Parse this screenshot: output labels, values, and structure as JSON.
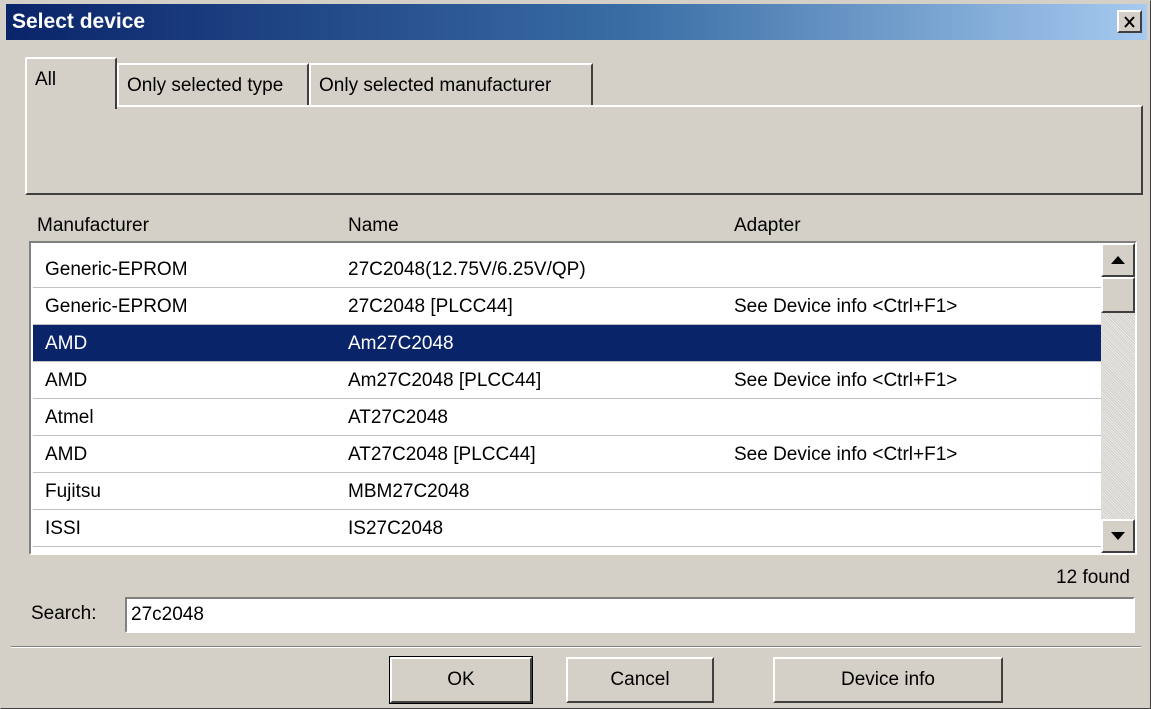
{
  "window": {
    "title": "Select device"
  },
  "tabs": [
    {
      "label": "All",
      "active": true
    },
    {
      "label": "Only selected type",
      "active": false
    },
    {
      "label": "Only selected manufacturer",
      "active": false
    }
  ],
  "columns": {
    "manufacturer": "Manufacturer",
    "name": "Name",
    "adapter": "Adapter"
  },
  "devices": [
    {
      "manufacturer": "Generic-EPROM",
      "name": "27C2048(12.75V/6.25V/QP)",
      "adapter": "",
      "selected": false
    },
    {
      "manufacturer": "Generic-EPROM",
      "name": "27C2048 [PLCC44]",
      "adapter": "See Device info <Ctrl+F1>",
      "selected": false
    },
    {
      "manufacturer": "AMD",
      "name": "Am27C2048",
      "adapter": "",
      "selected": true
    },
    {
      "manufacturer": "AMD",
      "name": "Am27C2048 [PLCC44]",
      "adapter": "See Device info <Ctrl+F1>",
      "selected": false
    },
    {
      "manufacturer": "Atmel",
      "name": "AT27C2048",
      "adapter": "",
      "selected": false
    },
    {
      "manufacturer": "AMD",
      "name": "AT27C2048 [PLCC44]",
      "adapter": "See Device info <Ctrl+F1>",
      "selected": false
    },
    {
      "manufacturer": "Fujitsu",
      "name": "MBM27C2048",
      "adapter": "",
      "selected": false
    },
    {
      "manufacturer": "ISSI",
      "name": "IS27C2048",
      "adapter": "",
      "selected": false
    }
  ],
  "results": {
    "found_text": "12 found"
  },
  "search": {
    "label": "Search:",
    "value": "27c2048"
  },
  "buttons": {
    "ok": "OK",
    "cancel": "Cancel",
    "device_info": "Device info"
  },
  "colors": {
    "titlebar_start": "#0a246a",
    "titlebar_end": "#a6caf0",
    "selection": "#0a246a",
    "face": "#d4d0c8"
  }
}
